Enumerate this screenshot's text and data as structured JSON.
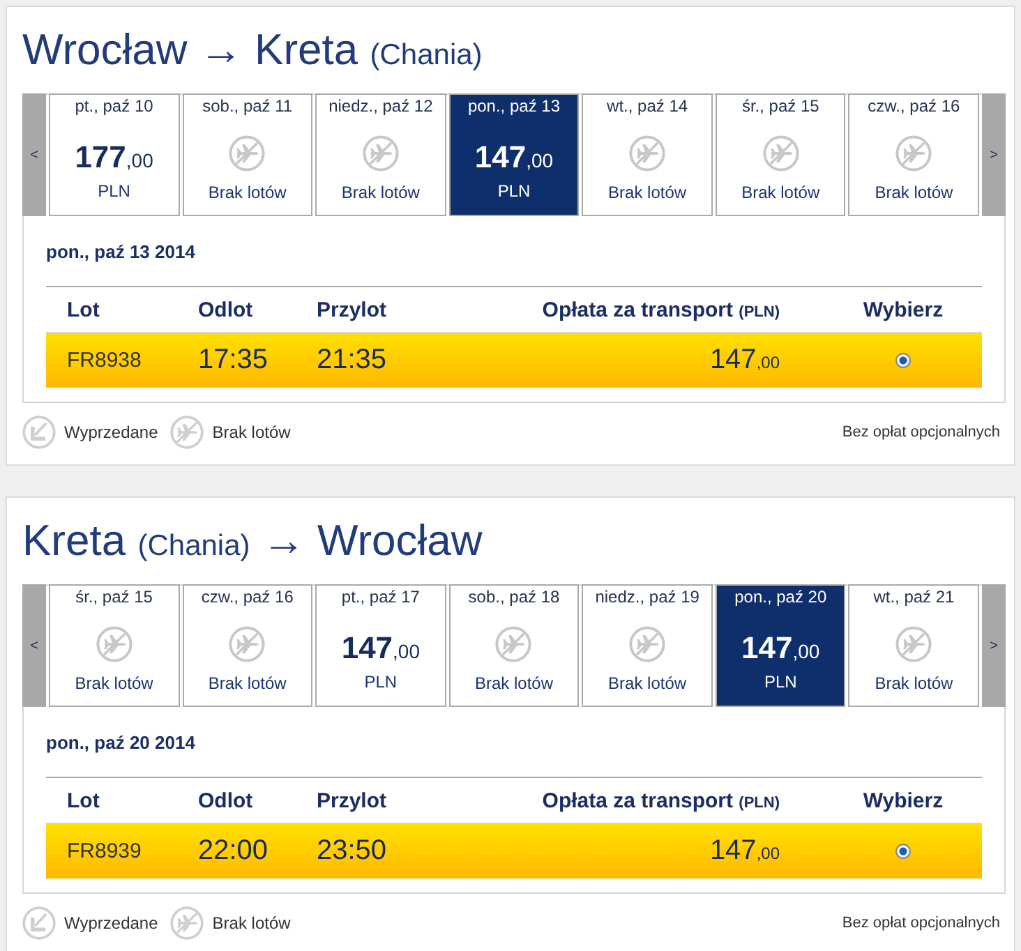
{
  "sections": [
    {
      "title": [
        {
          "kind": "city",
          "text": "Wrocław"
        },
        {
          "kind": "arrow",
          "text": "→"
        },
        {
          "kind": "city",
          "text": "Kreta"
        },
        {
          "kind": "detail",
          "text": "(Chania)"
        }
      ],
      "prev": "<",
      "next": ">",
      "dates": [
        {
          "day": "pt., paź 10",
          "kind": "fare",
          "amount": "177",
          "decimals": ",00",
          "currency": "PLN",
          "selected": false
        },
        {
          "day": "sob., paź 11",
          "kind": "none",
          "label": "Brak lotów",
          "selected": false
        },
        {
          "day": "niedz., paź 12",
          "kind": "none",
          "label": "Brak lotów",
          "selected": false
        },
        {
          "day": "pon., paź 13",
          "kind": "fare",
          "amount": "147",
          "decimals": ",00",
          "currency": "PLN",
          "selected": true
        },
        {
          "day": "wt., paź 14",
          "kind": "none",
          "label": "Brak lotów",
          "selected": false
        },
        {
          "day": "śr., paź 15",
          "kind": "none",
          "label": "Brak lotów",
          "selected": false
        },
        {
          "day": "czw., paź 16",
          "kind": "none",
          "label": "Brak lotów",
          "selected": false
        }
      ],
      "selected_date": "pon., paź 13 2014",
      "columns": [
        {
          "label": "Lot"
        },
        {
          "label": "Odlot"
        },
        {
          "label": "Przylot"
        },
        {
          "label": "Opłata za transport",
          "unit": "(PLN)"
        },
        {
          "label": "Wybierz"
        }
      ],
      "rows": [
        {
          "flight": "FR8938",
          "departure": "17:35",
          "arrival": "21:35",
          "amount": "147",
          "decimals": ",00",
          "selected": true
        }
      ],
      "legend": [
        {
          "kind": "sold_out",
          "label": "Wyprzedane"
        },
        {
          "kind": "no_flights",
          "label": "Brak lotów"
        }
      ],
      "note": "Bez opłat opcjonalnych"
    },
    {
      "title": [
        {
          "kind": "city",
          "text": "Kreta"
        },
        {
          "kind": "detail",
          "text": "(Chania)"
        },
        {
          "kind": "arrow",
          "text": "→"
        },
        {
          "kind": "city",
          "text": "Wrocław"
        }
      ],
      "prev": "<",
      "next": ">",
      "dates": [
        {
          "day": "śr., paź 15",
          "kind": "none",
          "label": "Brak lotów",
          "selected": false
        },
        {
          "day": "czw., paź 16",
          "kind": "none",
          "label": "Brak lotów",
          "selected": false
        },
        {
          "day": "pt., paź 17",
          "kind": "fare",
          "amount": "147",
          "decimals": ",00",
          "currency": "PLN",
          "selected": false
        },
        {
          "day": "sob., paź 18",
          "kind": "none",
          "label": "Brak lotów",
          "selected": false
        },
        {
          "day": "niedz., paź 19",
          "kind": "none",
          "label": "Brak lotów",
          "selected": false
        },
        {
          "day": "pon., paź 20",
          "kind": "fare",
          "amount": "147",
          "decimals": ",00",
          "currency": "PLN",
          "selected": true
        },
        {
          "day": "wt., paź 21",
          "kind": "none",
          "label": "Brak lotów",
          "selected": false
        }
      ],
      "selected_date": "pon., paź 20 2014",
      "columns": [
        {
          "label": "Lot"
        },
        {
          "label": "Odlot"
        },
        {
          "label": "Przylot"
        },
        {
          "label": "Opłata za transport",
          "unit": "(PLN)"
        },
        {
          "label": "Wybierz"
        }
      ],
      "rows": [
        {
          "flight": "FR8939",
          "departure": "22:00",
          "arrival": "23:50",
          "amount": "147",
          "decimals": ",00",
          "selected": true
        }
      ],
      "legend": [
        {
          "kind": "sold_out",
          "label": "Wyprzedane"
        },
        {
          "kind": "no_flights",
          "label": "Brak lotów"
        }
      ],
      "note": "Bez opłat opcjonalnych"
    }
  ]
}
